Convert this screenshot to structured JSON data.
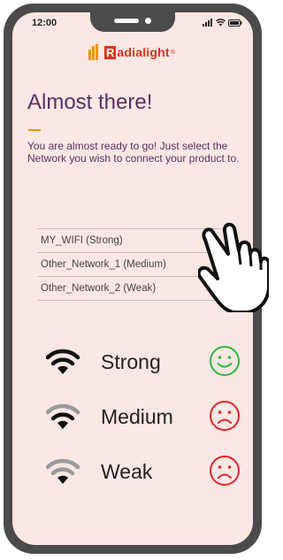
{
  "status_bar": {
    "time": "12:00"
  },
  "logo": {
    "text": "adialight",
    "mark_letter": "R",
    "reg": "®"
  },
  "title": "Almost there!",
  "description": "You are almost ready to go! Just select the Network you wish to connect your product to.",
  "networks": [
    {
      "label": "MY_WIFI  (Strong)"
    },
    {
      "label": "Other_Network_1  (Medium)"
    },
    {
      "label": "Other_Network_2  (Weak)"
    }
  ],
  "legend": [
    {
      "label": "Strong",
      "face": "happy",
      "wifi_color": "#111111",
      "face_color": "#2db83d"
    },
    {
      "label": "Medium",
      "face": "sad",
      "wifi_color": "#4a4a4a",
      "face_color": "#e3242b"
    },
    {
      "label": "Weak",
      "face": "sad",
      "wifi_color": "#9a9a9a",
      "face_color": "#e3242b"
    }
  ],
  "colors": {
    "background": "#fbe7e4",
    "accent": "#f39200",
    "title": "#5a2f61",
    "phone": "#4b4b4b"
  }
}
